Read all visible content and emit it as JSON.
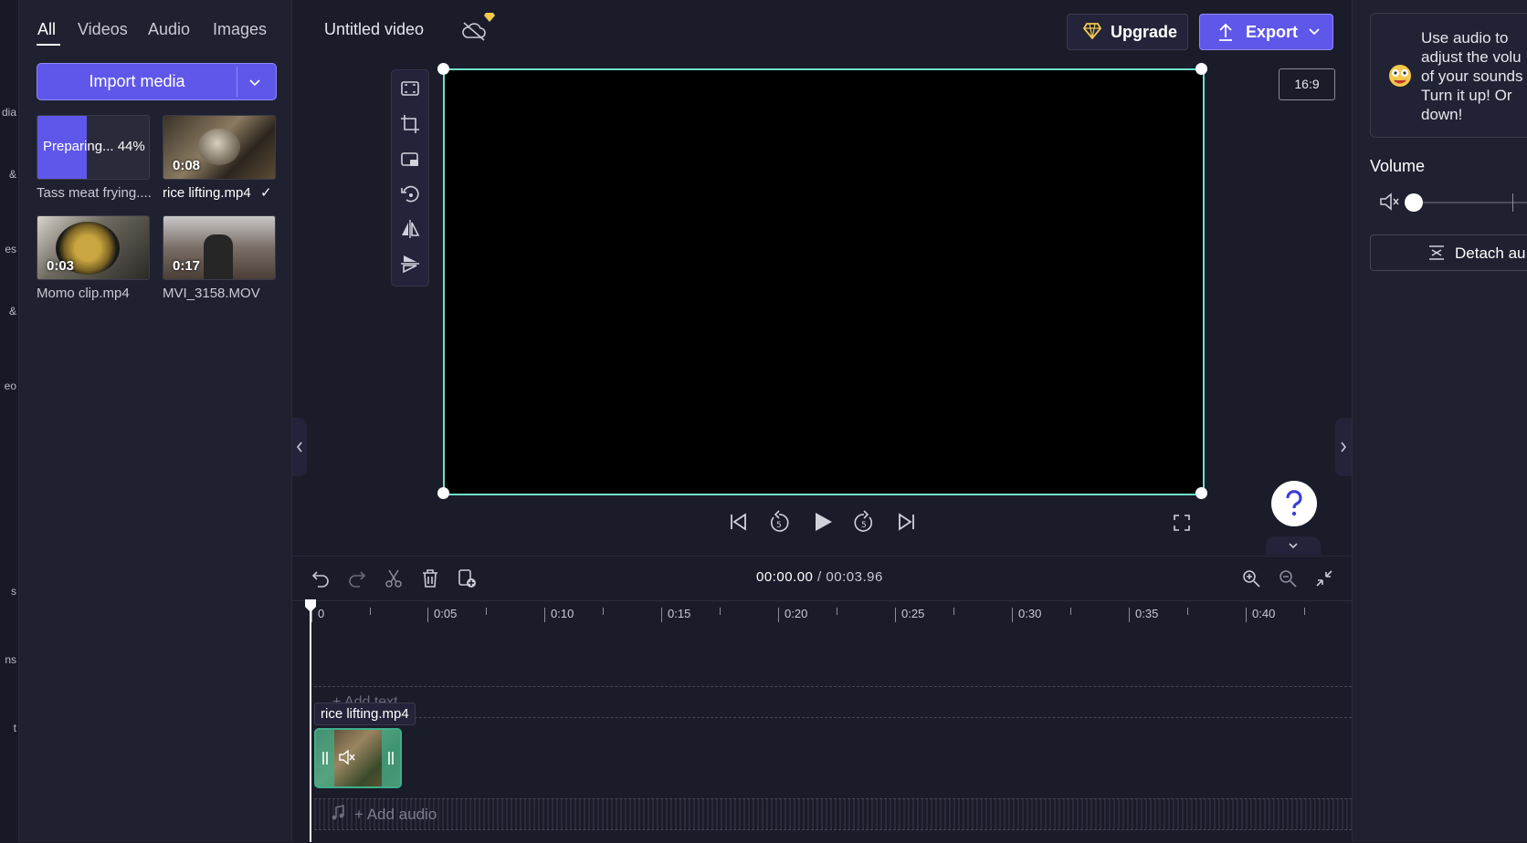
{
  "rail": {
    "items": [
      "dia",
      "&",
      "es",
      "&",
      "eo",
      "s",
      "ns",
      "t"
    ]
  },
  "media": {
    "tabs": [
      "All",
      "Videos",
      "Audio",
      "Images"
    ],
    "import_label": "Import media",
    "items": [
      {
        "name": "Tass meat frying....",
        "status": "Preparing... 44%",
        "progress": 0.44
      },
      {
        "name": "rice lifting.mp4",
        "duration": "0:08",
        "checked": "✓"
      },
      {
        "name": "Momo clip.mp4",
        "duration": "0:03"
      },
      {
        "name": "MVI_3158.MOV",
        "duration": "0:17"
      }
    ]
  },
  "header": {
    "title": "Untitled video",
    "upgrade_label": "Upgrade",
    "export_label": "Export"
  },
  "preview": {
    "aspect_ratio": "16:9"
  },
  "timeline": {
    "current_time": "00:00.00",
    "sep": " / ",
    "total_time": "00:03.96",
    "ruler": [
      "0",
      "0:05",
      "0:10",
      "0:15",
      "0:20",
      "0:25",
      "0:30",
      "0:35",
      "0:40"
    ],
    "text_track": "+ Add text",
    "clip_name": "rice lifting.mp4",
    "audio_track": "+ Add audio"
  },
  "right_panel": {
    "tip": "Use audio to adjust the volu of your sounds Turn it up! Or down!",
    "volume_label": "Volume",
    "volume_level": 0,
    "detach_label": "Detach au"
  },
  "colors": {
    "accent": "#5f57ea",
    "selection": "#6fe0c8",
    "clip": "#3fae8a",
    "bg": "#1b1c2a"
  }
}
